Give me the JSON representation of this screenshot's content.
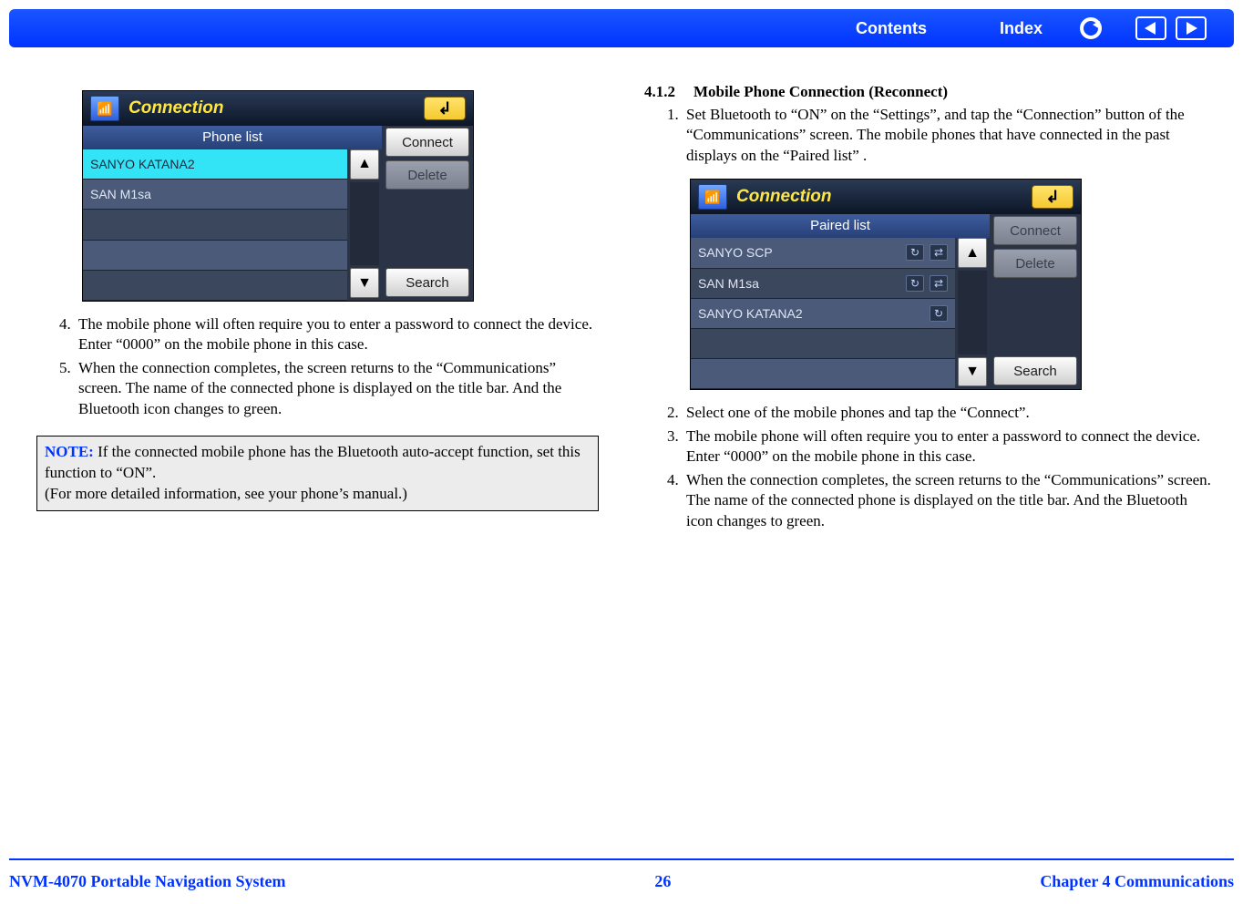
{
  "nav": {
    "contents": "Contents",
    "index": "Index"
  },
  "col_left": {
    "device": {
      "title": "Connection",
      "list_header": "Phone list",
      "rows": [
        {
          "label": "SANYO KATANA2",
          "selected": true,
          "icons": []
        },
        {
          "label": "SAN M1sa",
          "alt": true,
          "icons": []
        },
        {
          "label": "",
          "icons": []
        },
        {
          "label": "",
          "alt": true,
          "icons": []
        },
        {
          "label": "",
          "icons": []
        }
      ],
      "btn_connect": "Connect",
      "btn_delete": "Delete",
      "btn_search": "Search"
    },
    "steps_start": 4,
    "steps": [
      "The mobile phone will often require you to enter a password to connect the device. Enter “0000” on the mobile phone in this case.",
      "When the connection completes, the screen returns to the “Communications” screen. The name of the connected phone is displayed on the title bar. And the Bluetooth icon changes to green."
    ],
    "note_label": "NOTE:",
    "note_body": " If the connected mobile phone has the Bluetooth auto-accept function, set this function  to “ON”.\n(For more detailed information, see your phone’s manual.)"
  },
  "col_right": {
    "heading_num": "4.1.2",
    "heading_text": "Mobile Phone Connection (Reconnect)",
    "steps_a_start": 1,
    "steps_a": [
      "Set Bluetooth to “ON” on the “Settings”, and tap the “Connection” button of the “Communications” screen. The mobile phones that have connected in the past displays on the “Paired list” ."
    ],
    "device": {
      "title": "Connection",
      "list_header": "Paired list",
      "rows": [
        {
          "label": "SANYO SCP",
          "alt": true,
          "icons": [
            "↻",
            "⇄"
          ]
        },
        {
          "label": "SAN M1sa",
          "icons": [
            "↻",
            "⇄"
          ]
        },
        {
          "label": "SANYO KATANA2",
          "alt": true,
          "icons": [
            "↻"
          ]
        },
        {
          "label": "",
          "icons": []
        },
        {
          "label": "",
          "alt": true,
          "icons": []
        }
      ],
      "btn_connect": "Connect",
      "btn_delete": "Delete",
      "btn_search": "Search"
    },
    "steps_b_start": 2,
    "steps_b": [
      "Select one of the mobile phones and  tap the “Connect”.",
      "The mobile phone will often require you to enter a password to connect the device. Enter “0000” on the mobile phone in this case.",
      "When the connection completes, the screen returns to the “Communications” screen. The name of the connected phone is displayed on the title bar. And the Bluetooth icon changes to green."
    ]
  },
  "footer": {
    "left": "NVM-4070 Portable Navigation System",
    "center": "26",
    "right": "Chapter 4 Communications"
  }
}
